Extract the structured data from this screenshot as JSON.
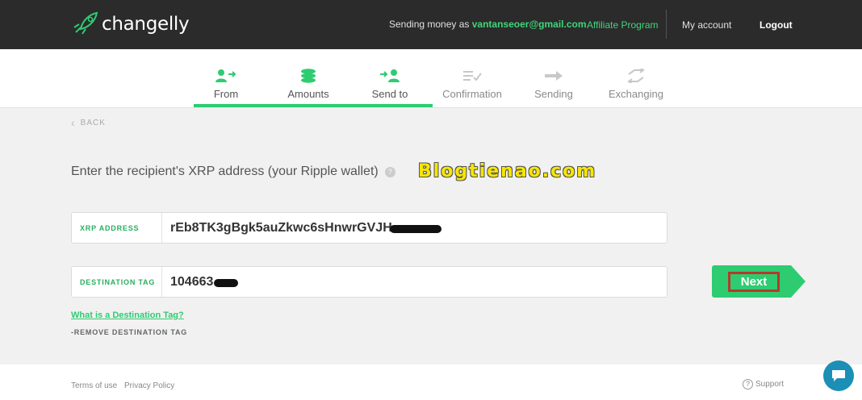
{
  "header": {
    "logo_text": "changelly",
    "sending_prefix": "Sending money as",
    "email": "vantanseoer@gmail.com",
    "affiliate": "Affiliate Program",
    "account": "My account",
    "logout": "Logout"
  },
  "steps": [
    {
      "label": "From",
      "icon": "user-send-icon",
      "state": "done"
    },
    {
      "label": "Amounts",
      "icon": "coins-stack-icon",
      "state": "done"
    },
    {
      "label": "Send to",
      "icon": "user-receive-icon",
      "state": "done"
    },
    {
      "label": "Confirmation",
      "icon": "checklist-icon",
      "state": "todo"
    },
    {
      "label": "Sending",
      "icon": "arrow-right-icon",
      "state": "todo"
    },
    {
      "label": "Exchanging",
      "icon": "exchange-icon",
      "state": "todo"
    }
  ],
  "back": "BACK",
  "prompt": "Enter the recipient's XRP address (your Ripple wallet)",
  "watermark": "Blogtienao.com",
  "form": {
    "address_label": "XRP ADDRESS",
    "address_value": "rEb8TK3gBgk5auZkwc6sHnwrGVJH",
    "tag_label": "DESTINATION TAG",
    "tag_value": "104663",
    "next": "Next"
  },
  "links": {
    "what_is_tag": "What is a Destination Tag?",
    "remove_tag": "-REMOVE DESTINATION TAG"
  },
  "footer": {
    "terms": "Terms of use",
    "privacy": "Privacy Policy",
    "support": "Support"
  },
  "colors": {
    "accent": "#2ecc71",
    "topbar": "#2b2b2b",
    "next_highlight": "#b33a2a"
  }
}
